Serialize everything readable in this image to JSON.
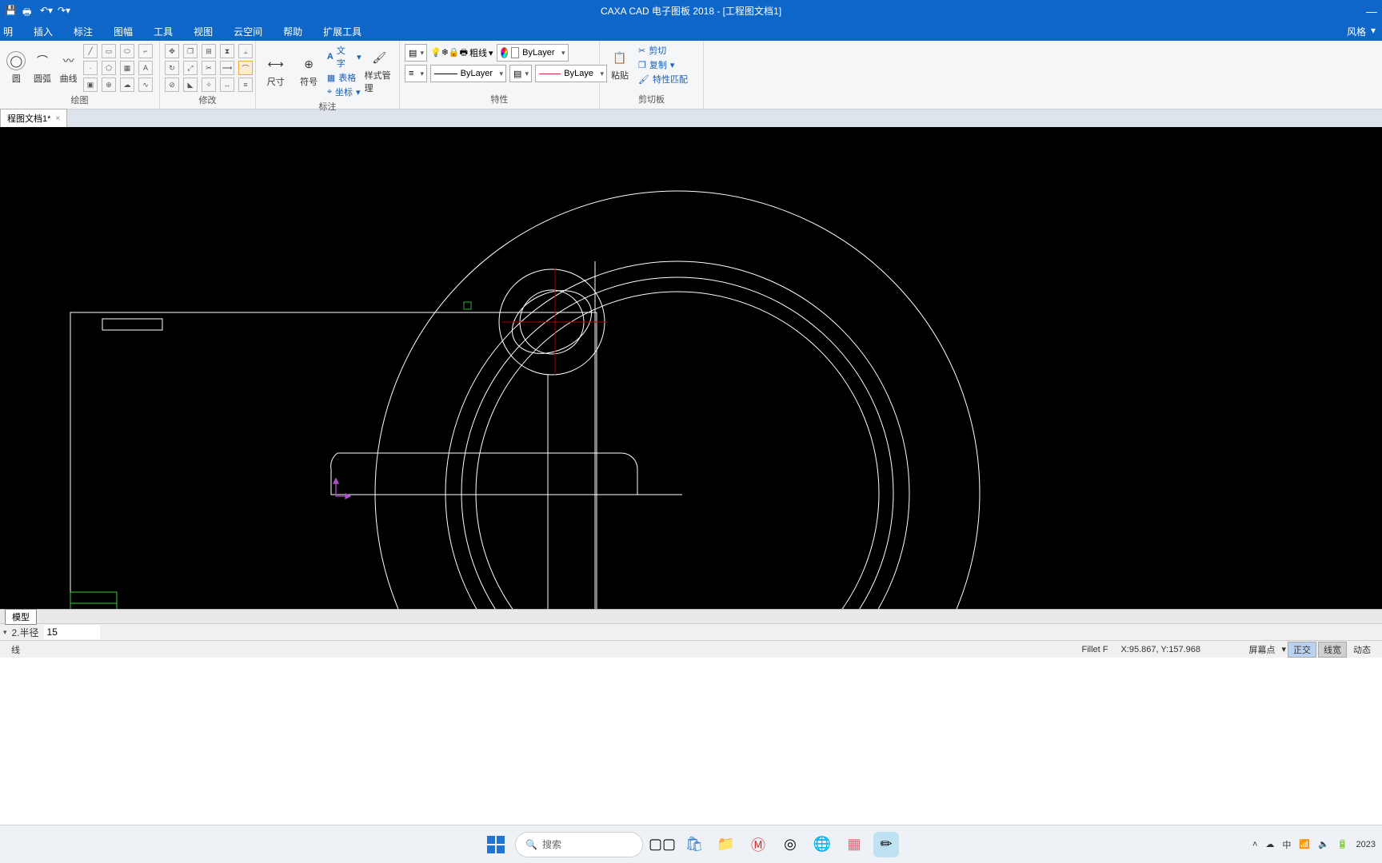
{
  "title": "CAXA CAD 电子图板 2018 - [工程图文档1]",
  "menubar": {
    "items": [
      "明",
      "插入",
      "标注",
      "图幅",
      "工具",
      "视图",
      "云空间",
      "帮助",
      "扩展工具"
    ],
    "right": "风格"
  },
  "ribbon": {
    "draw": {
      "label": "绘图",
      "btns": {
        "circle": "圆",
        "arc": "圆弧",
        "spline": "曲线"
      }
    },
    "modify": {
      "label": "修改"
    },
    "annot": {
      "label": "标注",
      "dim": "尺寸",
      "sym": "符号",
      "style": "样式管理",
      "text": "文字",
      "table": "表格",
      "coord": "坐标"
    },
    "prop": {
      "label": "特性",
      "lw": "粗线",
      "bylayer": "ByLayer",
      "bylayer2": "ByLaye",
      "bylayer3": "ByLayer"
    },
    "clip": {
      "label": "剪切板",
      "paste": "粘贴",
      "cut": "剪切",
      "copy": "复制",
      "match": "特性匹配"
    }
  },
  "doctab": {
    "name": "程图文档1*"
  },
  "sheettab": "模型",
  "cmdrow": {
    "label": "2.半径",
    "value": "15"
  },
  "status": {
    "left": "线",
    "cmd": "Fillet F",
    "coord": "X:95.867, Y:157.968",
    "scrpt": "屏幕点",
    "ortho": "正交",
    "lw": "线宽",
    "dyn": "动态"
  },
  "taskbar": {
    "search": "搜索",
    "ime": "中",
    "year": "2023"
  }
}
